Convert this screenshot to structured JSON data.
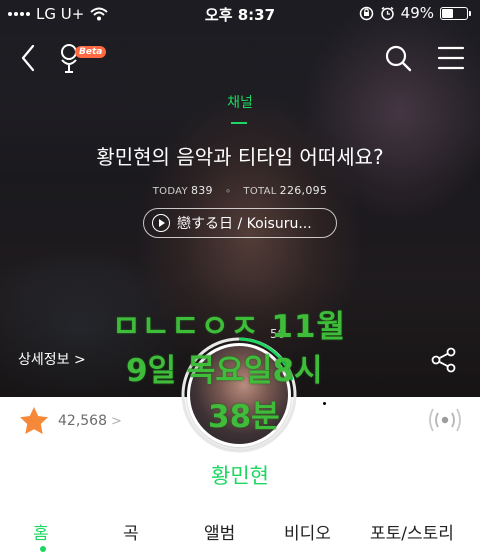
{
  "status_bar": {
    "carrier": "LG U+",
    "time": "오후 8:37",
    "battery_percent": "49%",
    "battery_level": 0.49
  },
  "nav": {
    "beta_badge": "Beta"
  },
  "channel": {
    "label": "채널",
    "title": "황민현의 음악과 티타임 어떠세요?",
    "today_label": "TODAY",
    "today_count": "839",
    "total_label": "TOTAL",
    "total_count": "226,095",
    "now_playing": "戀する日 / Koisuru..."
  },
  "detail_link": "상세정보 >",
  "overlay": {
    "line1": "ㅁㄴㄷㅇㅈ 11월",
    "line2": "9일 목요일8시",
    "line3": "38분",
    "badge_number": "50"
  },
  "profile": {
    "likes_count": "42,568",
    "likes_chevron": ">",
    "artist_name": "황민현"
  },
  "tabs": [
    "홈",
    "곡",
    "앨범",
    "비디오",
    "포토/스토리"
  ],
  "colors": {
    "accent": "#1ed760",
    "star": "#f6883a",
    "overlay_text": "#3fbd3a"
  }
}
